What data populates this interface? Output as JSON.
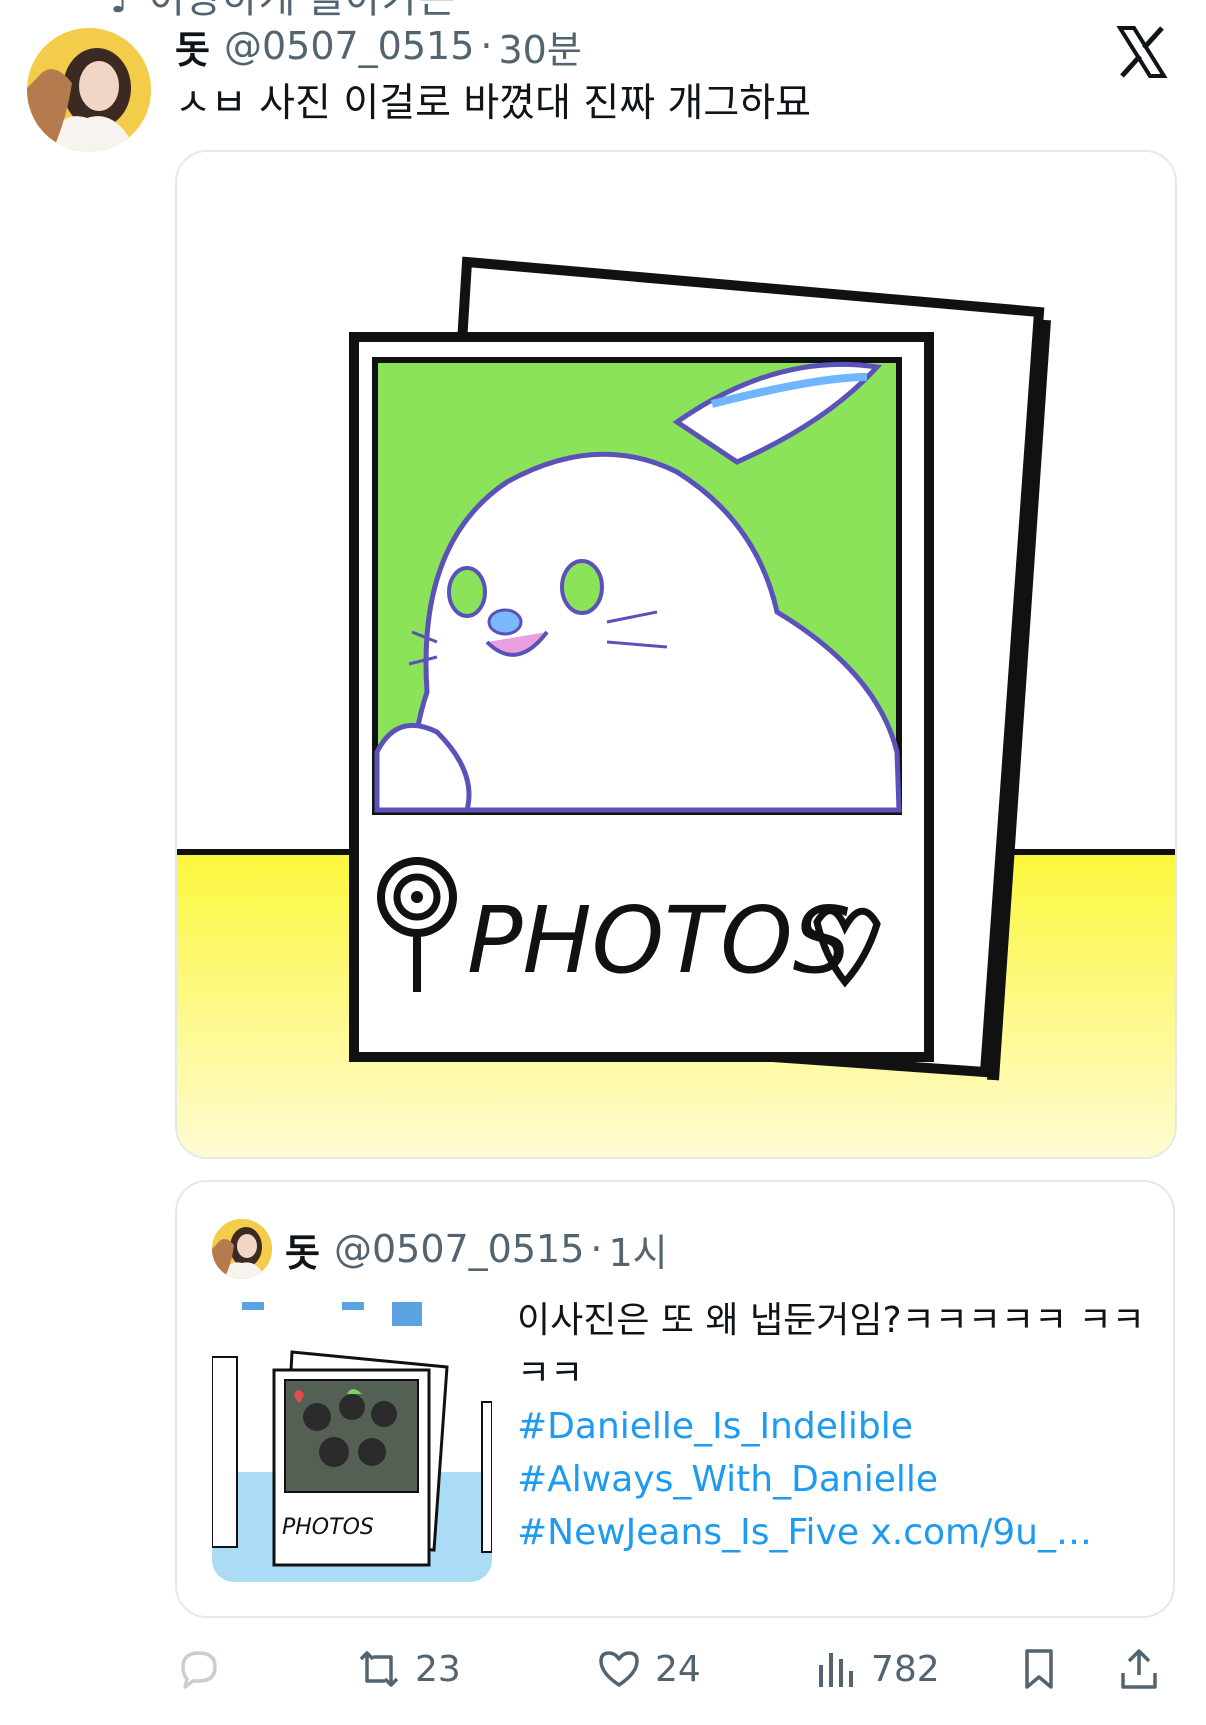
{
  "header": {
    "clipped_line": "♪ 이상하게 돌아가는",
    "name": "돗",
    "handle": "@0507_0515",
    "separator": "·",
    "time": "30분",
    "text": "ㅅㅂ 사진 이걸로 바꼈대 진짜 개그하묘"
  },
  "media": {
    "photo_caption": "PHOTOS"
  },
  "quote": {
    "name": "돗",
    "handle": "@0507_0515",
    "separator": "·",
    "time": "1시",
    "text": "이사진은 또 왜 냅둔거임?ㅋㅋㅋㅋㅋ ㅋㅋㅋㅋ",
    "hashtags": [
      "#Danielle_Is_Indelible",
      "#Always_With_Danielle",
      "#NewJeans_Is_Five"
    ],
    "link": "x.com/9u_…",
    "thumb_caption": "PHOTOS"
  },
  "actions": {
    "reply_count": "",
    "retweet_count": "23",
    "like_count": "24",
    "view_count": "782"
  },
  "colors": {
    "link": "#1d9bf0",
    "muted": "#536471",
    "yellow": "#fbf73b",
    "green": "#8be35a"
  },
  "icons": [
    "x-logo-icon",
    "reply-icon",
    "retweet-icon",
    "like-icon",
    "views-icon",
    "bookmark-icon",
    "share-icon"
  ]
}
